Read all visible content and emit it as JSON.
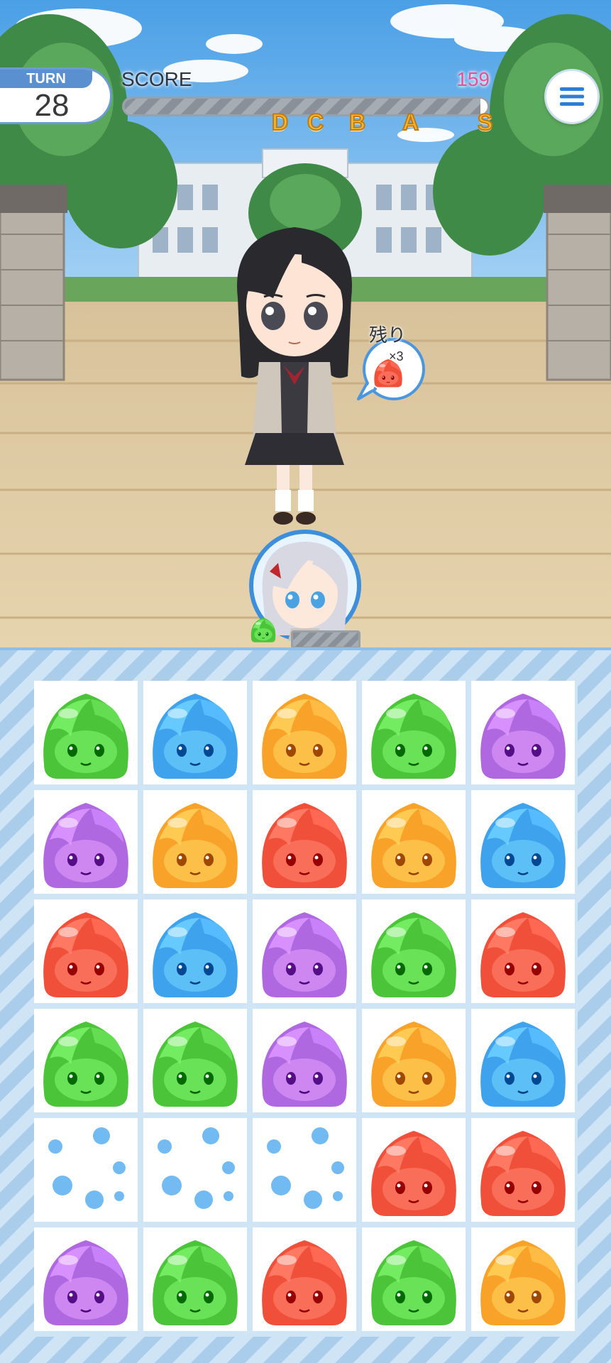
{
  "hud": {
    "turn_label": "TURN",
    "turn_value": "28",
    "score_label": "SCORE",
    "score_value": "159",
    "score_progress": 0.98,
    "ranks": [
      "D",
      "C",
      "B",
      "A",
      "S"
    ]
  },
  "bubble": {
    "label": "残り",
    "count": "×3",
    "target_color": "red"
  },
  "player": {
    "gauge_color": "green"
  },
  "colors": {
    "red": "#f0503a",
    "orange": "#f9a22a",
    "green": "#4cc43a",
    "blue": "#3ea2ec",
    "purple": "#b068e0",
    "accent_blue": "#5a8fd0",
    "score_pink": "#e0549a",
    "rank_gold": "#f2b733"
  },
  "board": {
    "rows": [
      [
        "green",
        "blue",
        "orange",
        "green",
        "purple"
      ],
      [
        "purple",
        "orange",
        "red",
        "orange",
        "blue"
      ],
      [
        "red",
        "blue",
        "purple",
        "green",
        "red"
      ],
      [
        "green",
        "green",
        "purple",
        "orange",
        "blue"
      ],
      [
        "empty",
        "empty",
        "empty",
        "red",
        "red"
      ],
      [
        "purple",
        "green",
        "red",
        "green",
        "orange"
      ]
    ]
  }
}
